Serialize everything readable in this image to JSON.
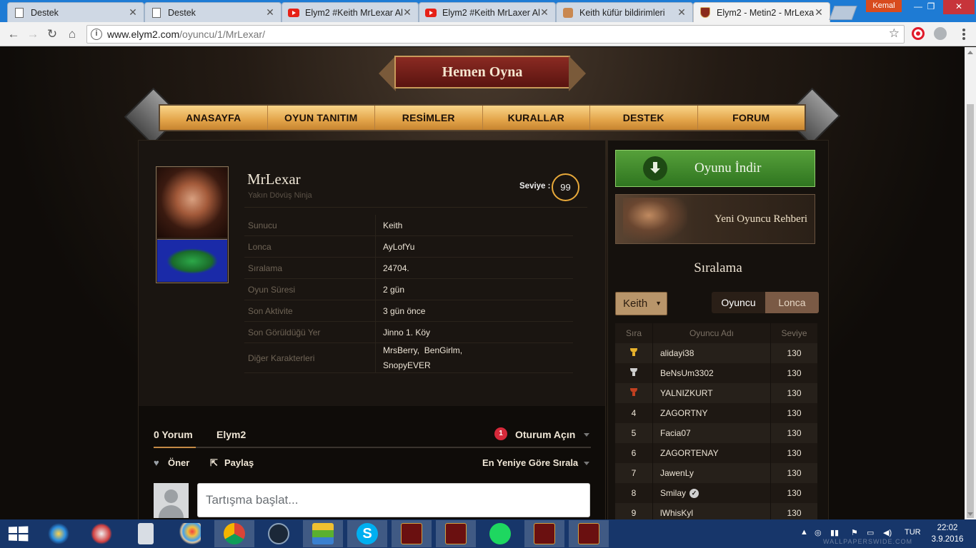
{
  "browser": {
    "tabs": [
      {
        "title": "Destek",
        "icon": "document-icon"
      },
      {
        "title": "Destek",
        "icon": "document-icon"
      },
      {
        "title": "Elym2 #Keith MrLexar Al",
        "icon": "youtube-icon"
      },
      {
        "title": "Elym2 #Keith MrLaxer Al",
        "icon": "youtube-icon"
      },
      {
        "title": "Keith küfür bildirimleri",
        "icon": "puzzle-icon"
      },
      {
        "title": "Elym2 - Metin2 - MrLexa",
        "icon": "shield-icon"
      }
    ],
    "profile_name": "Kemal",
    "url_host": "www.elym2.com",
    "url_path": "/oyuncu/1/MrLexar/"
  },
  "site": {
    "play_button": "Hemen Oyna",
    "nav": [
      "ANASAYFA",
      "OYUN TANITIM",
      "RESİMLER",
      "KURALLAR",
      "DESTEK",
      "FORUM"
    ]
  },
  "player": {
    "name": "MrLexar",
    "class": "Yakın Dövüş Ninja",
    "level_label": "Seviye :",
    "level": "99",
    "info": [
      {
        "key": "Sunucu",
        "value": "Keith"
      },
      {
        "key": "Lonca",
        "value": "AyLofYu"
      },
      {
        "key": "Sıralama",
        "value": "24704."
      },
      {
        "key": "Oyun Süresi",
        "value": "2 gün"
      },
      {
        "key": "Son Aktivite",
        "value": "3 gün önce"
      },
      {
        "key": "Son Görüldüğü Yer",
        "value": "Jinno 1. Köy"
      }
    ],
    "other_chars_label": "Diğer Karakterleri",
    "other_chars_line1": "MrsBerry,  BenGirlm,",
    "other_chars_line2": "SnopyEVER"
  },
  "comments": {
    "count_tab": "0 Yorum",
    "site_tab": "Elym2",
    "login_badge": "1",
    "login": "Oturum Açın",
    "recommend": "Öner",
    "share": "Paylaş",
    "sort": "En Yeniye Göre Sırala",
    "placeholder": "Tartışma başlat..."
  },
  "sidebar": {
    "download": "Oyunu İndir",
    "guide": "Yeni Oyuncu Rehberi",
    "ranking_title": "Sıralama",
    "server_select": "Keith",
    "toggle_player": "Oyuncu",
    "toggle_guild": "Lonca",
    "table_headers": [
      "Sıra",
      "Oyuncu Adı",
      "Seviye"
    ],
    "rows": [
      {
        "rank": "",
        "medal": "gold",
        "name": "alidayi38",
        "level": "130"
      },
      {
        "rank": "",
        "medal": "silver",
        "name": "BeNsUm3302",
        "level": "130"
      },
      {
        "rank": "",
        "medal": "bronze",
        "name": "YALNIZKURT",
        "level": "130"
      },
      {
        "rank": "4",
        "medal": "",
        "name": "ZAGORTNY",
        "level": "130"
      },
      {
        "rank": "5",
        "medal": "",
        "name": "Facia07",
        "level": "130"
      },
      {
        "rank": "6",
        "medal": "",
        "name": "ZAGORTENAY",
        "level": "130"
      },
      {
        "rank": "7",
        "medal": "",
        "name": "JawenLy",
        "level": "130"
      },
      {
        "rank": "8",
        "medal": "",
        "name": "Smilay",
        "level": "130",
        "verified": true
      },
      {
        "rank": "9",
        "medal": "",
        "name": "lWhisKyl",
        "level": "130"
      }
    ]
  },
  "taskbar": {
    "language": "TUR",
    "time": "22:02",
    "date": "3.9.2016",
    "watermark": "WALLPAPERSWIDE.COM"
  },
  "colors": {
    "nav_gold": "#e3a449",
    "download_green": "#3f8a2a",
    "level_ring": "#e8a93a",
    "chrome_blue": "#1e7bd4",
    "taskbar": "#17366a"
  }
}
